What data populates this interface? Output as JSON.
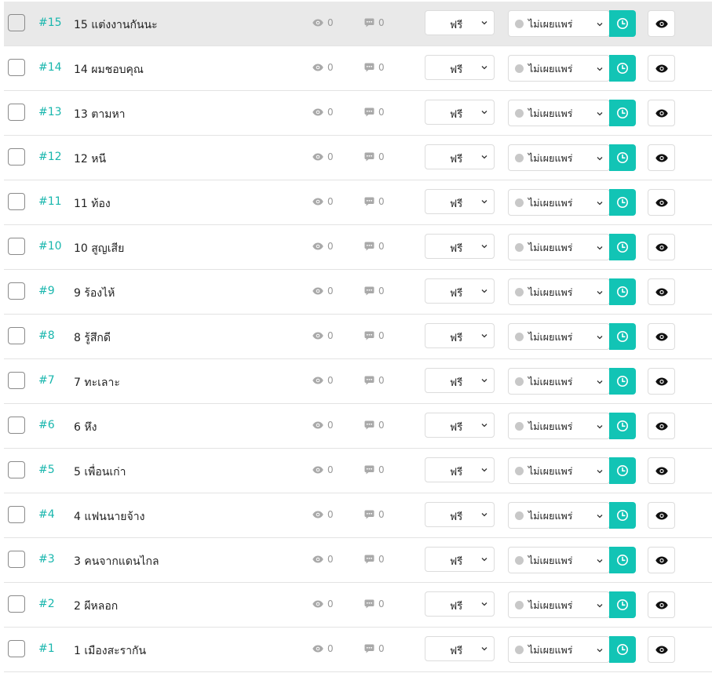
{
  "episodes": [
    {
      "num": "#15",
      "title": "15 แต่งงานกันนะ",
      "views": "0",
      "comments": "0",
      "price": "ฟรี",
      "status": "ไม่เผยแพร่",
      "selected": false
    },
    {
      "num": "#14",
      "title": "14 ผมชอบคุณ",
      "views": "0",
      "comments": "0",
      "price": "ฟรี",
      "status": "ไม่เผยแพร่",
      "selected": false
    },
    {
      "num": "#13",
      "title": "13 ตามหา",
      "views": "0",
      "comments": "0",
      "price": "ฟรี",
      "status": "ไม่เผยแพร่",
      "selected": false
    },
    {
      "num": "#12",
      "title": "12 หนี",
      "views": "0",
      "comments": "0",
      "price": "ฟรี",
      "status": "ไม่เผยแพร่",
      "selected": false
    },
    {
      "num": "#11",
      "title": "11 ท้อง",
      "views": "0",
      "comments": "0",
      "price": "ฟรี",
      "status": "ไม่เผยแพร่",
      "selected": false
    },
    {
      "num": "#10",
      "title": "10 สูญเสีย",
      "views": "0",
      "comments": "0",
      "price": "ฟรี",
      "status": "ไม่เผยแพร่",
      "selected": false
    },
    {
      "num": "#9",
      "title": "9 ร้องไห้",
      "views": "0",
      "comments": "0",
      "price": "ฟรี",
      "status": "ไม่เผยแพร่",
      "selected": false
    },
    {
      "num": "#8",
      "title": "8 รู้สึกดี",
      "views": "0",
      "comments": "0",
      "price": "ฟรี",
      "status": "ไม่เผยแพร่",
      "selected": false
    },
    {
      "num": "#7",
      "title": "7 ทะเลาะ",
      "views": "0",
      "comments": "0",
      "price": "ฟรี",
      "status": "ไม่เผยแพร่",
      "selected": false
    },
    {
      "num": "#6",
      "title": "6 หึง",
      "views": "0",
      "comments": "0",
      "price": "ฟรี",
      "status": "ไม่เผยแพร่",
      "selected": false
    },
    {
      "num": "#5",
      "title": "5 เพื่อนเก่า",
      "views": "0",
      "comments": "0",
      "price": "ฟรี",
      "status": "ไม่เผยแพร่",
      "selected": false
    },
    {
      "num": "#4",
      "title": "4 แฟนนายจ้าง",
      "views": "0",
      "comments": "0",
      "price": "ฟรี",
      "status": "ไม่เผยแพร่",
      "selected": false
    },
    {
      "num": "#3",
      "title": "3 คนจากแดนไกล",
      "views": "0",
      "comments": "0",
      "price": "ฟรี",
      "status": "ไม่เผยแพร่",
      "selected": false
    },
    {
      "num": "#2",
      "title": "2 ผีหลอก",
      "views": "0",
      "comments": "0",
      "price": "ฟรี",
      "status": "ไม่เผยแพร่",
      "selected": false
    },
    {
      "num": "#1",
      "title": "1 เมืองสะรากัน",
      "views": "0",
      "comments": "0",
      "price": "ฟรี",
      "status": "ไม่เผยแพร่",
      "selected": false
    }
  ],
  "colors": {
    "accent": "#12c4b5",
    "number": "#18b6ad",
    "hover_row": "#e9e9e9",
    "status_dot": "#c8c8c8"
  },
  "icons": {
    "views": "eye-icon",
    "comments": "comment-icon",
    "dropdown": "chevron-down-icon",
    "schedule": "clock-icon",
    "preview": "eye-icon"
  }
}
